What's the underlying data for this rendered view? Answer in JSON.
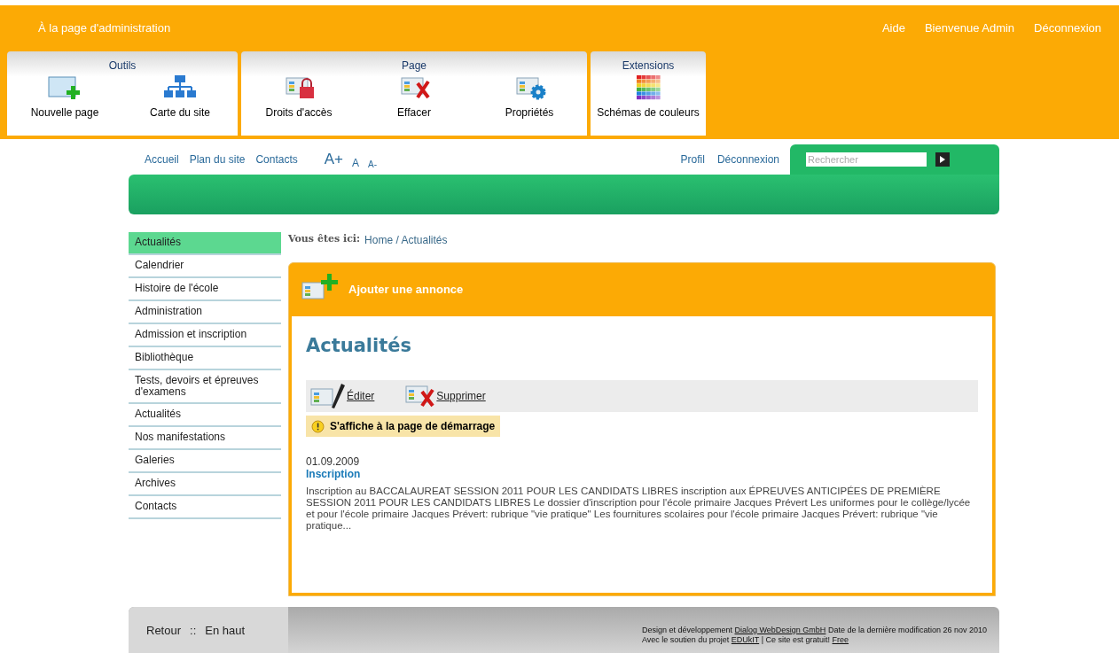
{
  "admin_bar": {
    "title": "À la page d'administration",
    "links": [
      "Aide",
      "Bienvenue Admin",
      "Déconnexion"
    ]
  },
  "toolbar": [
    {
      "title": "Outils",
      "tools": [
        {
          "label": "Nouvelle page",
          "kind": "new_page"
        },
        {
          "label": "Carte du site",
          "kind": "sitemap"
        }
      ]
    },
    {
      "title": "Page",
      "tools": [
        {
          "label": "Droits d'accès",
          "kind": "lock"
        },
        {
          "label": "Effacer",
          "kind": "delete"
        },
        {
          "label": "Propriétés",
          "kind": "properties"
        }
      ]
    },
    {
      "title": "Extensions",
      "tools": [
        {
          "label": "Schémas de couleurs",
          "kind": "colors"
        }
      ]
    }
  ],
  "site_nav": {
    "links": [
      "Accueil",
      "Plan du site",
      "Contacts"
    ],
    "font_sizes": [
      "A+",
      "A",
      "A-"
    ],
    "user_links": [
      "Profil",
      "Déconnexion"
    ],
    "search": {
      "placeholder": "Rechercher"
    }
  },
  "sidebar": {
    "items": [
      {
        "label": "Actualités",
        "selected": true
      },
      {
        "label": "Calendrier",
        "selected": false
      },
      {
        "label": "Histoire de l'école",
        "selected": false
      },
      {
        "label": "Administration",
        "selected": false
      },
      {
        "label": "Admission et inscription",
        "selected": false
      },
      {
        "label": "Bibliothèque",
        "selected": false
      },
      {
        "label": "Tests, devoirs et épreuves d'examens",
        "selected": false
      },
      {
        "label": "Actualités",
        "selected": false
      },
      {
        "label": "Nos manifestations",
        "selected": false
      },
      {
        "label": "Galeries",
        "selected": false
      },
      {
        "label": "Archives",
        "selected": false
      },
      {
        "label": "Contacts",
        "selected": false
      }
    ]
  },
  "breadcrumb": {
    "label": "Vous êtes ici:",
    "path": "Home / Actualités"
  },
  "content": {
    "add_button": "Ajouter une annonce",
    "heading": "Actualités",
    "actions": [
      {
        "label": "Éditer",
        "kind": "edit"
      },
      {
        "label": "Supprimer",
        "kind": "delete"
      }
    ],
    "notice": "S'affiche à la page de démarrage",
    "article": {
      "date": "01.09.2009",
      "title": "Inscription",
      "body": "Inscription au BACCALAUREAT SESSION 2011 POUR LES CANDIDATS LIBRES inscription aux ÉPREUVES ANTICIPÉES DE PREMIÈRE SESSION 2011 POUR LES CANDIDATS LIBRES Le dossier d'inscription pour l'école primaire Jacques Prévert Les uniformes pour le collège/lycée et pour l'école primaire Jacques Prévert: rubrique \"vie pratique\" Les fournitures scolaires pour l'école primaire Jacques Prévert: rubrique \"vie pratique..."
    }
  },
  "footer": {
    "links": [
      "Retour",
      "En haut"
    ],
    "separator": "::",
    "credits": [
      [
        {
          "text": "Design et développement ",
          "link": false
        },
        {
          "text": "Dialog WebDesign GmbH",
          "link": true
        },
        {
          "text": " Date de la dernière modification 26 nov 2010",
          "link": false
        }
      ],
      [
        {
          "text": "Avec le soutien du projet ",
          "link": false
        },
        {
          "text": "EDUkIT",
          "link": true
        },
        {
          "text": " | Ce site est gratuit! ",
          "link": false
        },
        {
          "text": "Free",
          "link": true
        }
      ]
    ]
  }
}
